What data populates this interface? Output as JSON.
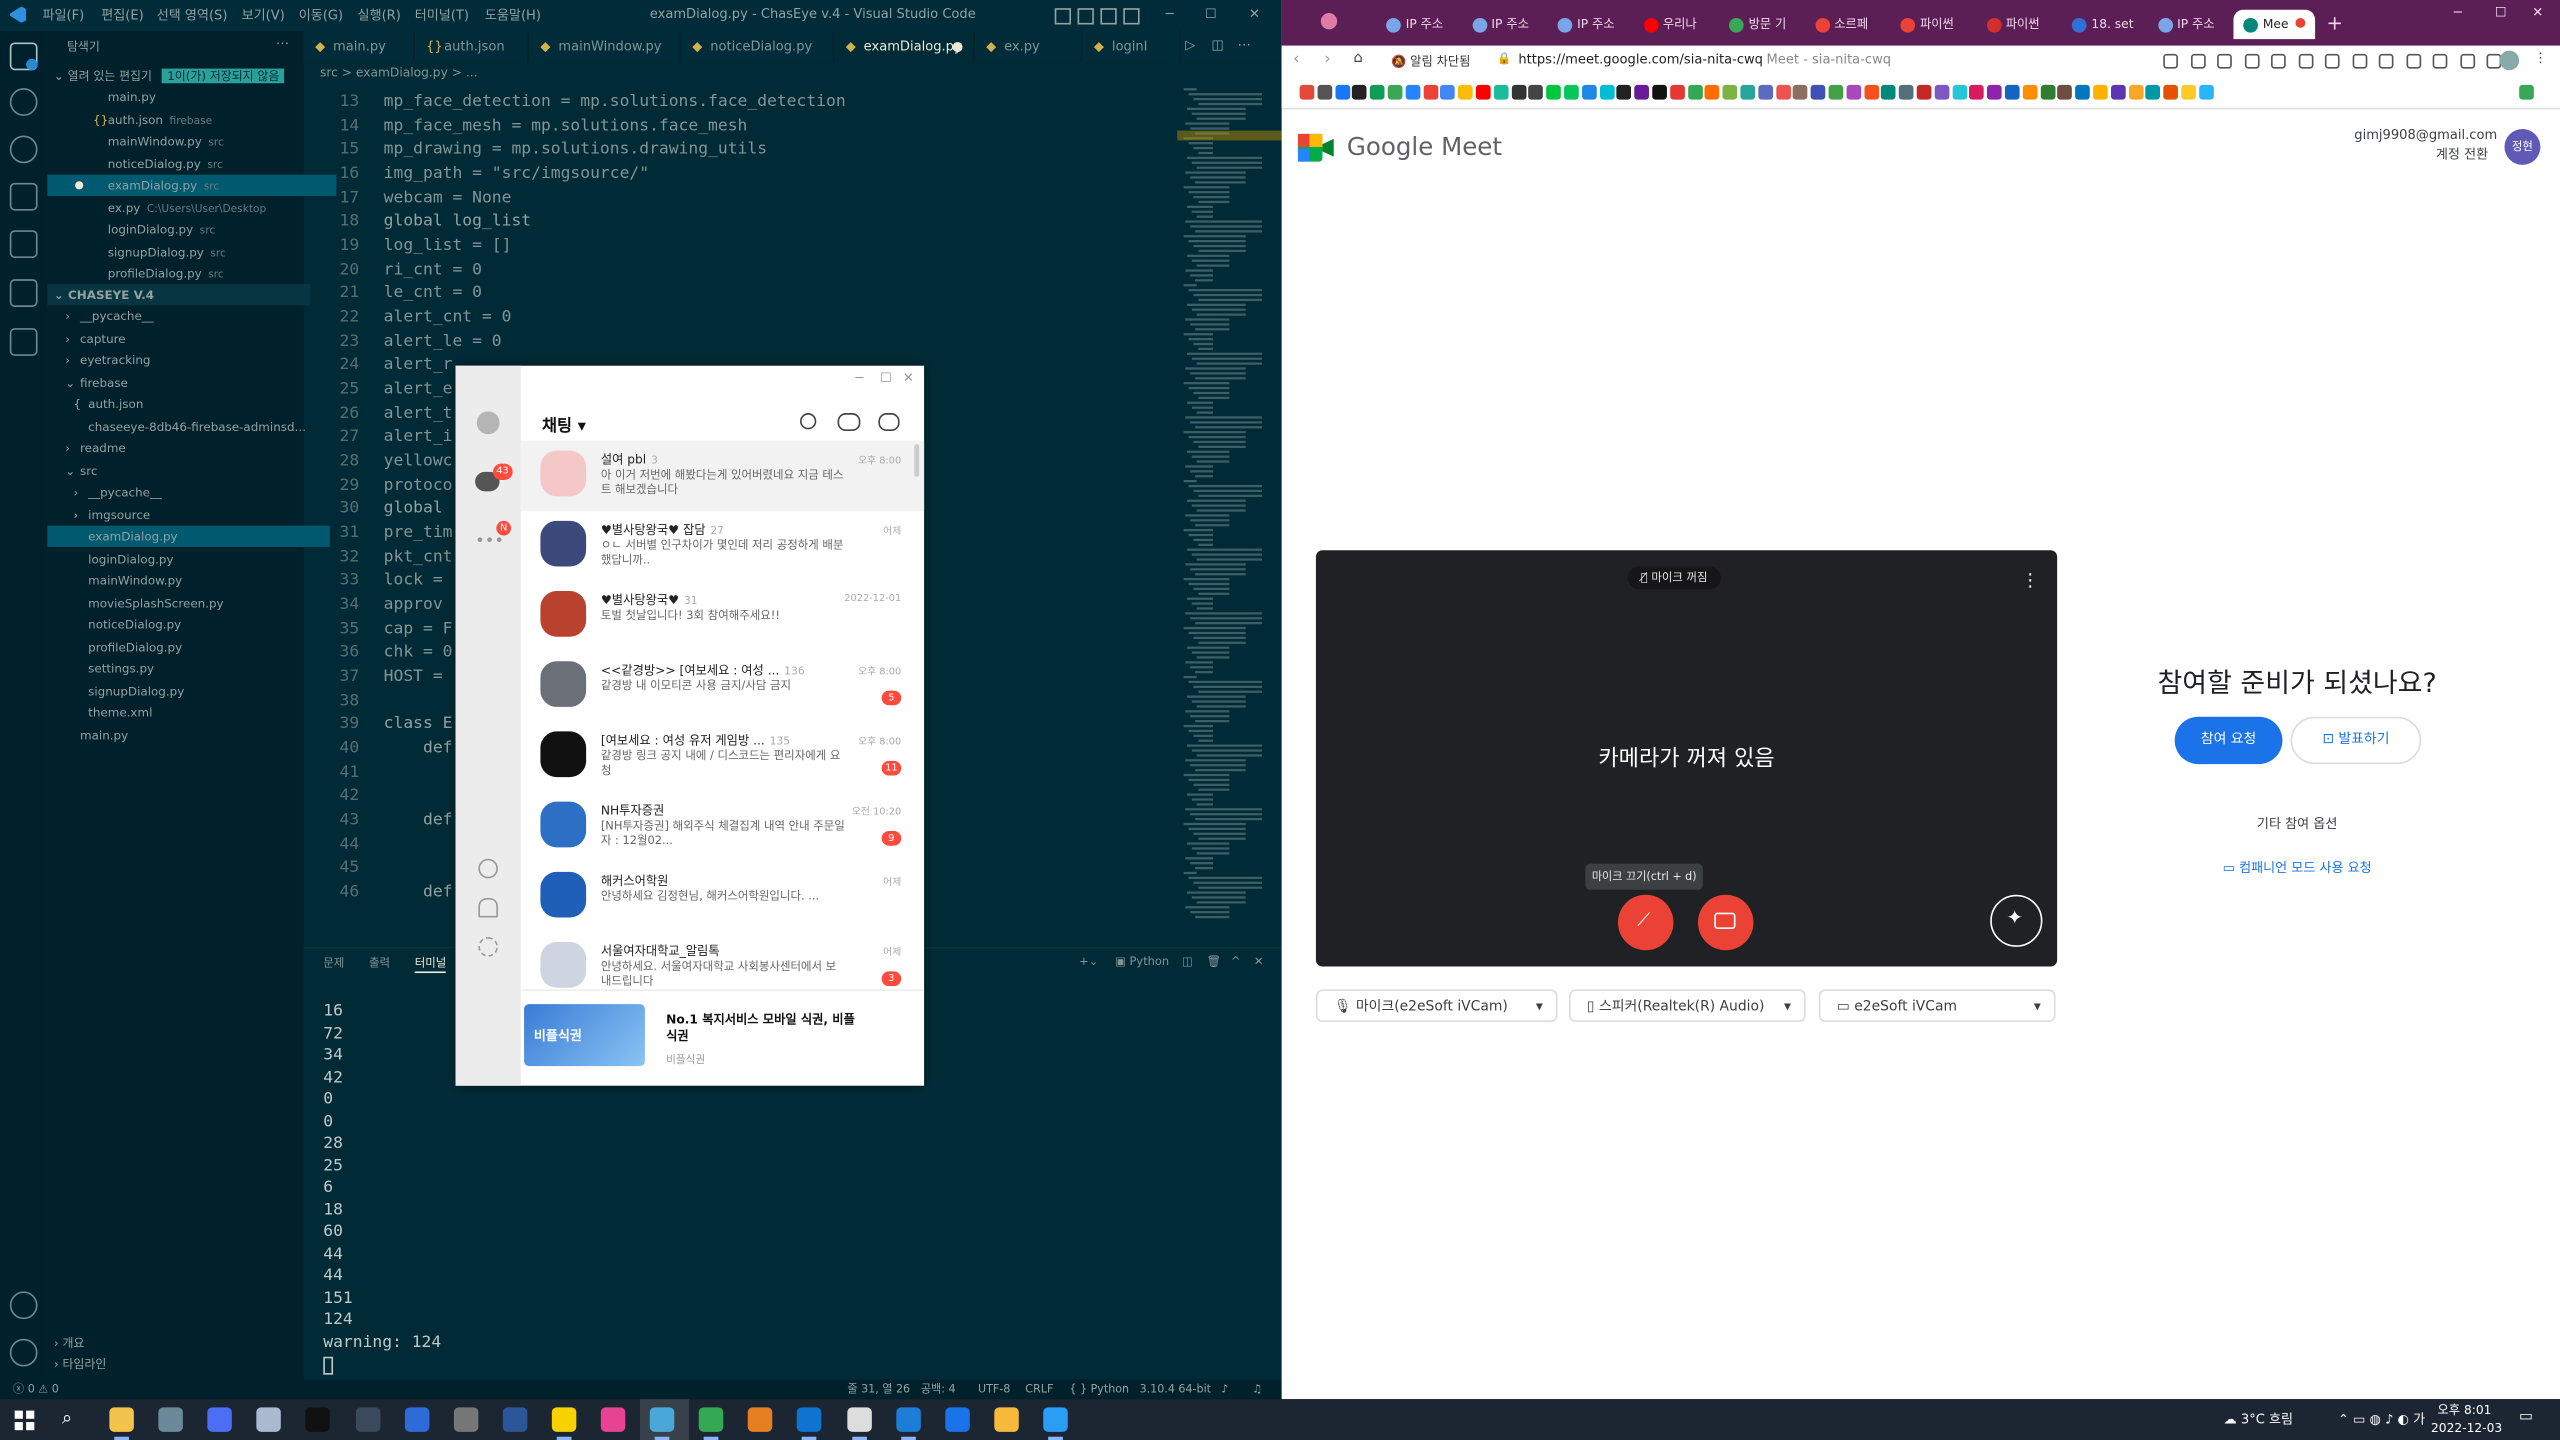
{
  "vscode": {
    "menus": [
      "파일(F)",
      "편집(E)",
      "선택 영역(S)",
      "보기(V)",
      "이동(G)",
      "실행(R)",
      "터미널(T)",
      "도움말(H)"
    ],
    "window_title": "examDialog.py - ChasEye v.4 - Visual Studio Code",
    "explorer_title": "탐색기",
    "open_editors": {
      "label": "열려 있는 편집기",
      "badge": "1이(가) 저장되지 않음"
    },
    "open_files": [
      {
        "name": "main.py",
        "hint": ""
      },
      {
        "name": "auth.json",
        "hint": "firebase"
      },
      {
        "name": "mainWindow.py",
        "hint": "src"
      },
      {
        "name": "noticeDialog.py",
        "hint": "src"
      },
      {
        "name": "examDialog.py",
        "hint": "src"
      },
      {
        "name": "ex.py",
        "hint": "C:\\Users\\User\\Desktop"
      },
      {
        "name": "loginDialog.py",
        "hint": "src"
      },
      {
        "name": "signupDialog.py",
        "hint": "src"
      },
      {
        "name": "profileDialog.py",
        "hint": "src"
      }
    ],
    "project": "CHASEYE V.4",
    "tree": [
      "__pycache__",
      "capture",
      "eyetracking",
      "firebase",
      "auth.json",
      "chaseeye-8db46-firebase-adminsd...",
      "readme",
      "src",
      "__pycache__",
      "imgsource",
      "examDialog.py",
      "loginDialog.py",
      "mainWindow.py",
      "movieSplashScreen.py",
      "noticeDialog.py",
      "profileDialog.py",
      "settings.py",
      "signupDialog.py",
      "theme.xml",
      "main.py"
    ],
    "outline": [
      "개요",
      "타임라인"
    ],
    "tabs": [
      "main.py",
      "auth.json",
      "mainWindow.py",
      "noticeDialog.py",
      "examDialog.py",
      "ex.py",
      "loginI"
    ],
    "breadcrumb": "src > examDialog.py > ...",
    "line_numbers": [
      "13",
      "14",
      "15",
      "16",
      "17",
      "18",
      "19",
      "20",
      "21",
      "22",
      "23",
      "24",
      "25",
      "26",
      "27",
      "28",
      "29",
      "30",
      "31",
      "32",
      "33",
      "34",
      "35",
      "36",
      "37",
      "38",
      "39",
      "40",
      "41",
      "42",
      "43",
      "44",
      "45",
      "46"
    ],
    "code_lines": [
      "mp_face_detection = mp.solutions.face_detection",
      "mp_face_mesh = mp.solutions.face_mesh",
      "mp_drawing = mp.solutions.drawing_utils",
      "img_path = \"src/imgsource/\"",
      "webcam = None",
      "global log_list",
      "log_list = []",
      "ri_cnt = 0",
      "le_cnt = 0",
      "alert_cnt = 0",
      "alert_le = 0",
      "alert_r",
      "alert_e",
      "alert_t",
      "alert_i",
      "yellowc",
      "protoco",
      "global",
      "pre_tim",
      "pkt_cnt",
      "lock = ",
      "approv",
      "cap = F",
      "chk = 0",
      "HOST = ",
      "",
      "class E",
      "    def",
      "",
      "",
      "    def",
      "",
      "",
      "    def"
    ],
    "panel_tabs": [
      "문제",
      "출력",
      "터미널"
    ],
    "panel_lang": "Python",
    "terminal_lines": [
      "16",
      "72",
      "34",
      "42",
      "0",
      "0",
      "28",
      "25",
      "6",
      "18",
      "60",
      "44",
      "44",
      "151",
      "124",
      "warning: 124"
    ],
    "status": {
      "errors": "0",
      "warnings": "0",
      "position": "줄 31, 열 26",
      "spaces": "공백: 4",
      "encoding": "UTF-8",
      "eol": "CRLF",
      "lang": "Python",
      "version": "3.10.4 64-bit"
    }
  },
  "kakao": {
    "title": "채팅",
    "chat_badge": "43",
    "more_badge": "N",
    "chats": [
      {
        "name": "설여 pbl",
        "count": "3",
        "msg": "아 이거 저번에 해봤다는게 있어버렸네요 지금 테스트 해보겠습니다",
        "time": "오후 8:00",
        "badge": "",
        "color": "#f5c8c8"
      },
      {
        "name": "♥별사탕왕국♥ 잡담",
        "count": "27",
        "msg": "ㅇㄴ 서버별 인구차이가 몇인데 저리 공정하게 배분했답니까..",
        "time": "어제",
        "badge": "",
        "color": "#3b4a7a"
      },
      {
        "name": "♥별사탕왕국♥",
        "count": "31",
        "msg": "토벌 첫날입니다! 3회 참여해주세요!!",
        "time": "2022-12-01",
        "badge": "",
        "color": "#b9422f"
      },
      {
        "name": "<<같경방>> [여보세요 : 여성 ...",
        "count": "136",
        "msg": "같경방 내 이모티콘 사용 금지/사담 금지",
        "time": "오후 8:00",
        "badge": "5",
        "color": "#6b6f78"
      },
      {
        "name": "[여보세요 : 여성 유저 게임방 ...",
        "count": "135",
        "msg": "같경방 링크 공지 내에 / 디스코드는 편리자에게 요청",
        "time": "오후 8:00",
        "badge": "11",
        "color": "#111111"
      },
      {
        "name": "NH투자증권",
        "count": "",
        "msg": "[NH투자증권] 해외주식 체결집계 내역 안내 주문일자 : 12월02...",
        "time": "오전 10:20",
        "badge": "9",
        "color": "#2d6fc4"
      },
      {
        "name": "해커스어학원",
        "count": "",
        "msg": "안녕하세요 김정현님, 해커스어학원입니다. ...",
        "time": "어제",
        "badge": "",
        "color": "#1f5fb8"
      },
      {
        "name": "서울여자대학교_알림톡",
        "count": "",
        "msg": "안녕하세요. 서울여자대학교 사회봉사센터에서 보내드립니다",
        "time": "어제",
        "badge": "3",
        "color": "#cfd5e0"
      }
    ],
    "ad_title": "No.1 복지서비스 모바일 식권, 비플식권",
    "ad_sub": "비플식권",
    "ad_img_text": "비플식권"
  },
  "chrome": {
    "tabs": [
      {
        "label": "IP 주소",
        "color": "#7aa6e8"
      },
      {
        "label": "IP 주소",
        "color": "#7aa6e8"
      },
      {
        "label": "IP 주소",
        "color": "#7aa6e8"
      },
      {
        "label": "우리나",
        "color": "#ff0000"
      },
      {
        "label": "방문 기",
        "color": "#3aa757"
      },
      {
        "label": "소르페",
        "color": "#ea4335"
      },
      {
        "label": "파이썬",
        "color": "#ea4335"
      },
      {
        "label": "파이썬",
        "color": "#d32f2f"
      },
      {
        "label": "18. set",
        "color": "#2f6fd6"
      },
      {
        "label": "IP 주소",
        "color": "#7aa6e8"
      },
      {
        "label": "Mee",
        "color": "#00897b"
      }
    ],
    "popup_blocked": "알림 차단됨",
    "url": "https://meet.google.com/sia-nita-cwq",
    "url_title": "Meet - sia-nita-cwq",
    "brand": "Google Meet",
    "account_email": "gimj9908@gmail.com",
    "account_switch": "계정 전환",
    "avatar_text": "정현",
    "mic_off_chip": "마이크 꺼짐",
    "camera_off": "카메라가 꺼져 있음",
    "mic_tooltip": "마이크 끄기(ctrl + d)",
    "ready_title": "참여할 준비가 되셨나요?",
    "join_button": "참여 요청",
    "present_button": "발표하기",
    "other_options": "기타 참여 옵션",
    "companion": "컴패니언 모드 사용 요청",
    "mic_device": "마이크(e2eSoft iVCam)",
    "speaker_device": "스피커(Realtek(R) Audio)",
    "camera_device": "e2eSoft iVCam",
    "accent": "#1a73e8",
    "danger": "#ea4335"
  },
  "taskbar": {
    "weather": "3°C 흐림",
    "time": "오후 8:01",
    "date": "2022-12-03",
    "icons": [
      "file-explorer",
      "settings",
      "calculator",
      "notepad",
      "terminal",
      "media",
      "powershell",
      "gear",
      "word",
      "kakaotalk",
      "itunes",
      "vscode-insiders",
      "chrome",
      "game",
      "vscode",
      "notes",
      "photo",
      "vscode-dev",
      "folder",
      "messenger"
    ]
  }
}
